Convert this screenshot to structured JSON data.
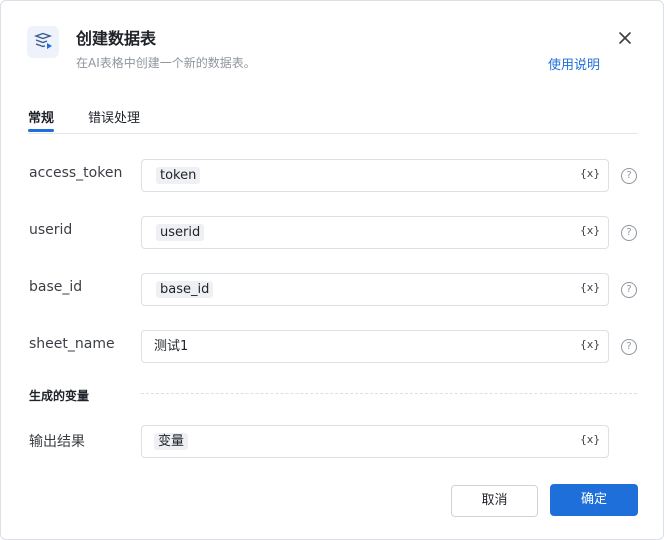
{
  "dialog": {
    "title": "创建数据表",
    "subtitle": "在AI表格中创建一个新的数据表。",
    "help_link": "使用说明"
  },
  "tabs": [
    {
      "label": "常规",
      "active": true
    },
    {
      "label": "错误处理",
      "active": false
    }
  ],
  "params": [
    {
      "label": "access_token",
      "value": "token",
      "chip": true
    },
    {
      "label": "userid",
      "value": "userid",
      "chip": true
    },
    {
      "label": "base_id",
      "value": "base_id",
      "chip": true
    },
    {
      "label": "sheet_name",
      "value": "测试1",
      "chip": false
    }
  ],
  "var_icon_text": "{x}",
  "help_icon_text": "?",
  "output_section": {
    "title": "生成的变量",
    "label": "输出结果",
    "value": "变量"
  },
  "buttons": {
    "cancel": "取消",
    "confirm": "确定"
  },
  "colors": {
    "accent": "#1e6fd9",
    "border": "#dcdfe6",
    "chip_bg": "#eef0f3"
  }
}
